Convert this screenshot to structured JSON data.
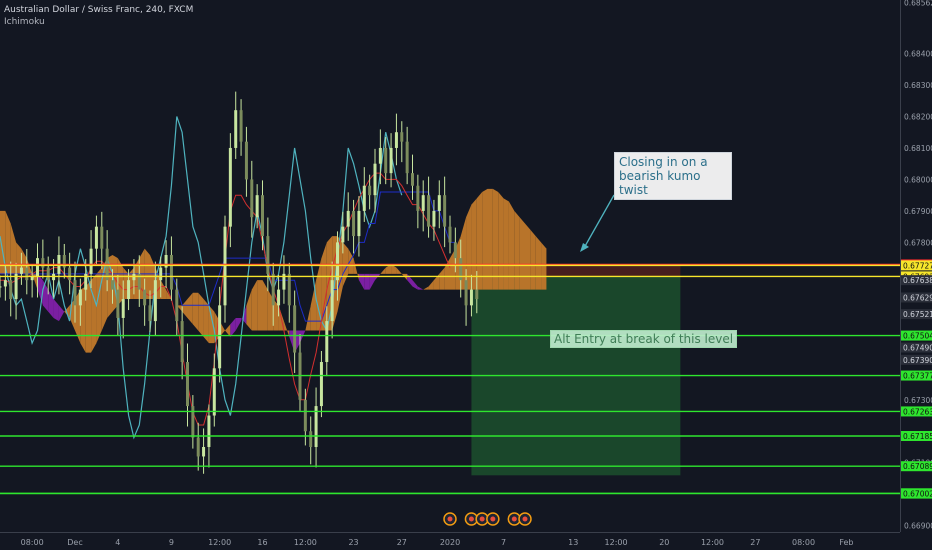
{
  "header": {
    "symbol": "Australian Dollar / Swiss Franc, 240, FXCM",
    "indicator": "Ichimoku"
  },
  "annotations": {
    "kumo_twist": "Closing in on a bearish kumo twist",
    "alt_entry": "Alt Entry at break of this level"
  },
  "colors": {
    "background": "#131722",
    "candle": "#c8e6a0",
    "tenkan": "#d32f2f",
    "kijun": "#1e2cc8",
    "chikou": "#4fb3bf",
    "kumo_bull": "#b8742a",
    "kumo_bear": "#7b1fa2",
    "level_red": "#ff2b2b",
    "level_yellow": "#f7e62b",
    "level_green": "#2ee62e",
    "profit_zone": "#1c4c2c",
    "loss_zone": "#4c1e1e"
  },
  "chart_data": {
    "type": "candlestick",
    "ylim": [
      0.6688,
      0.6857
    ],
    "x_index_range": [
      0,
      168
    ],
    "price_ticks": [
      "0.68562",
      "0.68400",
      "0.68300",
      "0.68200",
      "0.68100",
      "0.68000",
      "0.67900",
      "0.67800",
      "0.67300",
      "0.67100",
      "0.66900"
    ],
    "horizontal_levels": [
      {
        "value": 0.6773,
        "label": "0.67730",
        "color": "red"
      },
      {
        "value": 0.67727,
        "label": "0.67727",
        "color": "yellow"
      },
      {
        "value": 0.67692,
        "label": "0.67692",
        "color": "yellow"
      },
      {
        "value": 0.67504,
        "label": "0.67504",
        "color": "green"
      },
      {
        "value": 0.67377,
        "label": "0.67377",
        "color": "green"
      },
      {
        "value": 0.67263,
        "label": "0.67263",
        "color": "green"
      },
      {
        "value": 0.67185,
        "label": "0.67185",
        "color": "green"
      },
      {
        "value": 0.67089,
        "label": "0.67089",
        "color": "green"
      },
      {
        "value": 0.67003,
        "label": "0.67003",
        "color": "green"
      },
      {
        "value": 0.67002,
        "label": "0.67002",
        "color": "green"
      }
    ],
    "other_price_labels": [
      {
        "value": 0.6768,
        "label": "0.67638"
      },
      {
        "value": 0.67625,
        "label": "0.67629"
      },
      {
        "value": 0.67572,
        "label": "0.67521"
      },
      {
        "value": 0.67466,
        "label": "0.67490"
      },
      {
        "value": 0.67427,
        "label": "0.67390"
      }
    ],
    "time_ticks": [
      {
        "i": 6,
        "label": "08:00"
      },
      {
        "i": 14,
        "label": "Dec"
      },
      {
        "i": 22,
        "label": "4"
      },
      {
        "i": 32,
        "label": "9"
      },
      {
        "i": 41,
        "label": "12:00"
      },
      {
        "i": 49,
        "label": "16"
      },
      {
        "i": 57,
        "label": "12:00"
      },
      {
        "i": 66,
        "label": "23"
      },
      {
        "i": 75,
        "label": "27"
      },
      {
        "i": 84,
        "label": "2020"
      },
      {
        "i": 94,
        "label": "7"
      },
      {
        "i": 107,
        "label": "13"
      },
      {
        "i": 115,
        "label": "12:00"
      },
      {
        "i": 124,
        "label": "20"
      },
      {
        "i": 133,
        "label": "12:00"
      },
      {
        "i": 141,
        "label": "27"
      },
      {
        "i": 150,
        "label": "08:00"
      },
      {
        "i": 158,
        "label": "Feb"
      }
    ],
    "close": [
      0.6766,
      0.6768,
      0.6762,
      0.677,
      0.6772,
      0.6768,
      0.6769,
      0.6775,
      0.6772,
      0.6768,
      0.677,
      0.6776,
      0.6772,
      0.6768,
      0.676,
      0.6765,
      0.677,
      0.6778,
      0.6785,
      0.6778,
      0.6768,
      0.6765,
      0.6756,
      0.6762,
      0.6768,
      0.677,
      0.6765,
      0.676,
      0.6755,
      0.6768,
      0.6772,
      0.6776,
      0.6765,
      0.6755,
      0.6742,
      0.6728,
      0.6718,
      0.6712,
      0.6715,
      0.6725,
      0.674,
      0.676,
      0.6785,
      0.681,
      0.6822,
      0.6812,
      0.68,
      0.6788,
      0.6795,
      0.6782,
      0.677,
      0.676,
      0.6765,
      0.677,
      0.676,
      0.6745,
      0.673,
      0.672,
      0.6715,
      0.6728,
      0.6742,
      0.6755,
      0.6768,
      0.678,
      0.6785,
      0.679,
      0.6782,
      0.679,
      0.6798,
      0.6795,
      0.6805,
      0.681,
      0.6802,
      0.681,
      0.6815,
      0.6812,
      0.6802,
      0.6798,
      0.679,
      0.6795,
      0.6785,
      0.679,
      0.6795,
      0.6785,
      0.678,
      0.6775,
      0.6768,
      0.676,
      0.6765,
      0.6762
    ],
    "tenkan": [
      0.6768,
      0.6768,
      0.6767,
      0.6768,
      0.6769,
      0.6769,
      0.677,
      0.6771,
      0.6771,
      0.6771,
      0.6772,
      0.6772,
      0.677,
      0.6768,
      0.6766,
      0.6766,
      0.6768,
      0.6772,
      0.6774,
      0.6774,
      0.6772,
      0.677,
      0.6767,
      0.6765,
      0.6765,
      0.6766,
      0.6766,
      0.6764,
      0.6763,
      0.6764,
      0.6766,
      0.6766,
      0.6762,
      0.6755,
      0.6745,
      0.6735,
      0.6726,
      0.6722,
      0.6722,
      0.6728,
      0.6742,
      0.676,
      0.6775,
      0.679,
      0.6795,
      0.6795,
      0.6792,
      0.679,
      0.6788,
      0.678,
      0.6772,
      0.6765,
      0.676,
      0.6752,
      0.6743,
      0.6735,
      0.673,
      0.673,
      0.6738,
      0.6745,
      0.6755,
      0.6765,
      0.6772,
      0.6778,
      0.6783,
      0.6786,
      0.679,
      0.6794,
      0.6797,
      0.68,
      0.6802,
      0.6802,
      0.68,
      0.68,
      0.68,
      0.6798,
      0.6795,
      0.6792,
      0.6792,
      0.6789,
      0.6786,
      0.6784,
      0.678,
      0.6776,
      0.6772
    ],
    "kijun": [
      0.677,
      0.677,
      0.677,
      0.677,
      0.677,
      0.677,
      0.677,
      0.677,
      0.677,
      0.677,
      0.677,
      0.677,
      0.677,
      0.677,
      0.677,
      0.677,
      0.677,
      0.677,
      0.677,
      0.677,
      0.677,
      0.677,
      0.677,
      0.677,
      0.677,
      0.677,
      0.677,
      0.677,
      0.677,
      0.677,
      0.677,
      0.677,
      0.677,
      0.6766,
      0.676,
      0.676,
      0.676,
      0.676,
      0.676,
      0.676,
      0.6765,
      0.677,
      0.6775,
      0.6775,
      0.6775,
      0.6775,
      0.6775,
      0.6775,
      0.6775,
      0.6775,
      0.6775,
      0.6768,
      0.6768,
      0.6768,
      0.6768,
      0.6768,
      0.676,
      0.6755,
      0.6755,
      0.6755,
      0.6755,
      0.676,
      0.6765,
      0.6765,
      0.677,
      0.6773,
      0.6776,
      0.678,
      0.678,
      0.6786,
      0.6786,
      0.6796,
      0.6796,
      0.6796,
      0.6796,
      0.6796,
      0.6796,
      0.6796,
      0.6796,
      0.6796,
      0.6796,
      0.679,
      0.679,
      0.6785,
      0.678,
      0.678
    ],
    "chikou": [
      0.6782,
      0.6772,
      0.6765,
      0.676,
      0.6762,
      0.6755,
      0.6748,
      0.6752,
      0.6765,
      0.677,
      0.6762,
      0.6768,
      0.676,
      0.6755,
      0.677,
      0.6778,
      0.6772,
      0.6765,
      0.676,
      0.6768,
      0.6775,
      0.677,
      0.676,
      0.674,
      0.6725,
      0.6718,
      0.6722,
      0.6735,
      0.6752,
      0.6768,
      0.6775,
      0.6782,
      0.6798,
      0.682,
      0.6815,
      0.68,
      0.6785,
      0.678,
      0.677,
      0.676,
      0.6752,
      0.674,
      0.673,
      0.6725,
      0.6735,
      0.675,
      0.6765,
      0.678,
      0.679,
      0.6782,
      0.677,
      0.6765,
      0.677,
      0.678,
      0.6795,
      0.681,
      0.68,
      0.679,
      0.6775,
      0.6762,
      0.6755,
      0.6752,
      0.676,
      0.6775,
      0.679,
      0.681,
      0.6805,
      0.6798,
      0.679,
      0.6785,
      0.679,
      0.6802,
      0.6815,
      0.6808,
      0.68,
      0.6795
    ],
    "senkou_a": [
      0.679,
      0.679,
      0.6786,
      0.678,
      0.6778,
      0.6775,
      0.677,
      0.6765,
      0.676,
      0.6758,
      0.6756,
      0.6755,
      0.6758,
      0.676,
      0.6762,
      0.6765,
      0.6766,
      0.6768,
      0.677,
      0.6772,
      0.6775,
      0.6776,
      0.6775,
      0.6772,
      0.677,
      0.6772,
      0.6775,
      0.6778,
      0.6776,
      0.6772,
      0.6768,
      0.6765,
      0.6762,
      0.676,
      0.676,
      0.6762,
      0.6764,
      0.6764,
      0.6762,
      0.676,
      0.6758,
      0.6755,
      0.6752,
      0.675,
      0.6752,
      0.6755,
      0.676,
      0.6765,
      0.6768,
      0.6768,
      0.6765,
      0.6762,
      0.676,
      0.6755,
      0.675,
      0.6745,
      0.6748,
      0.6752,
      0.676,
      0.6768,
      0.6775,
      0.678,
      0.6782,
      0.6782,
      0.678,
      0.6778,
      0.6775,
      0.6768,
      0.6765,
      0.6765,
      0.6768,
      0.677,
      0.6772,
      0.6773,
      0.6772,
      0.677,
      0.6768,
      0.6766,
      0.6765,
      0.6765,
      0.6766,
      0.6768,
      0.677,
      0.6772,
      0.6775,
      0.6778,
      0.6782,
      0.6788,
      0.6792,
      0.6794,
      0.6796,
      0.6797,
      0.6797,
      0.6796,
      0.6794,
      0.6793,
      0.679,
      0.6788,
      0.6786,
      0.6784,
      0.6782,
      0.678,
      0.6778,
      0.6775
    ],
    "senkou_b": [
      0.677,
      0.677,
      0.677,
      0.677,
      0.677,
      0.677,
      0.677,
      0.677,
      0.6768,
      0.6765,
      0.6762,
      0.676,
      0.6758,
      0.6756,
      0.6752,
      0.6748,
      0.6745,
      0.6745,
      0.6748,
      0.6752,
      0.6756,
      0.6758,
      0.676,
      0.6762,
      0.6762,
      0.6762,
      0.6762,
      0.6762,
      0.6762,
      0.6762,
      0.6762,
      0.6762,
      0.6762,
      0.676,
      0.6758,
      0.6756,
      0.6754,
      0.6752,
      0.675,
      0.6748,
      0.6748,
      0.675,
      0.6752,
      0.6754,
      0.6756,
      0.6756,
      0.6754,
      0.6752,
      0.6752,
      0.6752,
      0.6752,
      0.6752,
      0.6752,
      0.6752,
      0.6752,
      0.6752,
      0.6752,
      0.6752,
      0.6752,
      0.6752,
      0.6752,
      0.6752,
      0.6752,
      0.6758,
      0.6766,
      0.677,
      0.677,
      0.677,
      0.677,
      0.677,
      0.677,
      0.677,
      0.677,
      0.677,
      0.677,
      0.677,
      0.677,
      0.6768,
      0.6766,
      0.6765,
      0.6765,
      0.6765,
      0.6765,
      0.6765,
      0.6765,
      0.6765,
      0.6765,
      0.6765,
      0.6765,
      0.6765,
      0.6765,
      0.6765,
      0.6765,
      0.6765,
      0.6765,
      0.6765,
      0.6765,
      0.6765,
      0.6765,
      0.6765,
      0.6765,
      0.6765,
      0.6765
    ],
    "positions": {
      "entry": 0.6773,
      "stop": 0.67727,
      "target": 0.67692,
      "start_i": 88,
      "end_i": 127,
      "top": 0.6773,
      "mid": 0.67692,
      "bottom": 0.6706
    },
    "event_markers_i": [
      84,
      88,
      90,
      92,
      96,
      98
    ]
  }
}
